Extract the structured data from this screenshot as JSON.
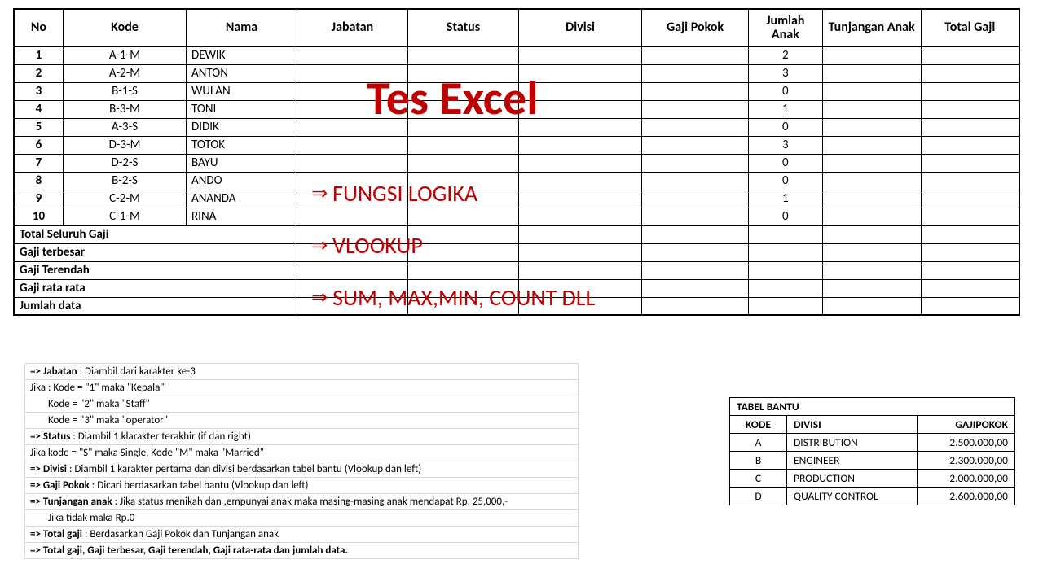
{
  "main_table": {
    "headers": [
      "No",
      "Kode",
      "Nama",
      "Jabatan",
      "Status",
      "Divisi",
      "Gaji Pokok",
      "Jumlah Anak",
      "Tunjangan Anak",
      "Total Gaji"
    ],
    "rows": [
      {
        "no": "1",
        "kode": "A-1-M",
        "nama": "DEWIK",
        "ja": "2"
      },
      {
        "no": "2",
        "kode": "A-2-M",
        "nama": "ANTON",
        "ja": "3"
      },
      {
        "no": "3",
        "kode": "B-1-S",
        "nama": "WULAN",
        "ja": "0"
      },
      {
        "no": "4",
        "kode": "B-3-M",
        "nama": "TONI",
        "ja": "1"
      },
      {
        "no": "5",
        "kode": "A-3-S",
        "nama": "DIDIK",
        "ja": "0"
      },
      {
        "no": "6",
        "kode": "D-3-M",
        "nama": "TOTOK",
        "ja": "3"
      },
      {
        "no": "7",
        "kode": "D-2-S",
        "nama": "BAYU",
        "ja": "0"
      },
      {
        "no": "8",
        "kode": "B-2-S",
        "nama": "ANDO",
        "ja": "0"
      },
      {
        "no": "9",
        "kode": "C-2-M",
        "nama": "ANANDA",
        "ja": "1"
      },
      {
        "no": "10",
        "kode": "C-1-M",
        "nama": "RINA",
        "ja": "0"
      }
    ],
    "summaries": [
      "Total Seluruh Gaji",
      "Gaji terbesar",
      "Gaji Terendah",
      "Gaji rata rata",
      "Jumlah data"
    ]
  },
  "overlay": {
    "title": "Tes Excel",
    "lines": [
      "FUNGSI LOGIKA",
      "VLOOKUP",
      "SUM, MAX,MIN, COUNT DLL"
    ]
  },
  "instructions": [
    {
      "text": "=> Jabatan : Diambil dari karakter ke-3",
      "boldPrefix": "=> Jabatan"
    },
    {
      "text": "Jika : Kode = \"1\" maka \"Kepala\""
    },
    {
      "text": "        Kode = \"2\" maka \"Staff\"",
      "indent": true
    },
    {
      "text": "        Kode = \"3\" maka \"operator\"",
      "indent": true
    },
    {
      "text": "=> Status : Diambil 1 klarakter terakhir (if dan right)",
      "boldPrefix": "=> Status"
    },
    {
      "text": "Jika kode = \"S\" maka Single, Kode \"M\" maka \"Married\""
    },
    {
      "text": "=> Divisi : Diambil 1 karakter pertama dan divisi berdasarkan tabel bantu (Vlookup dan left)",
      "boldPrefix": "=> Divisi"
    },
    {
      "text": "=> Gaji Pokok : Dicari berdasarkan tabel bantu (Vlookup dan left)",
      "boldPrefix": "=> Gaji Pokok"
    },
    {
      "text": "=> Tunjangan anak : Jika status menikah dan ,empunyai anak maka masing-masing anak mendapat Rp. 25,000,-",
      "boldPrefix": "=> Tunjangan anak"
    },
    {
      "text": "                              Jika  tidak maka Rp.0",
      "indent": true
    },
    {
      "text": "=> Total gaji : Berdasarkan Gaji Pokok dan Tunjangan anak",
      "boldPrefix": "=> Total gaji"
    },
    {
      "text": "=> Total gaji, Gaji terbesar, Gaji terendah, Gaji rata-rata dan jumlah data.",
      "bold": true
    }
  ],
  "tabel_bantu": {
    "title": "TABEL BANTU",
    "headers": [
      "KODE",
      "DIVISI",
      "GAJIPOKOK"
    ],
    "rows": [
      {
        "kode": "A",
        "divisi": "DISTRIBUTION",
        "gp": "2.500.000,00"
      },
      {
        "kode": "B",
        "divisi": "ENGINEER",
        "gp": "2.300.000,00"
      },
      {
        "kode": "C",
        "divisi": "PRODUCTION",
        "gp": "2.000.000,00"
      },
      {
        "kode": "D",
        "divisi": "QUALITY CONTROL",
        "gp": "2.600.000,00"
      }
    ]
  }
}
